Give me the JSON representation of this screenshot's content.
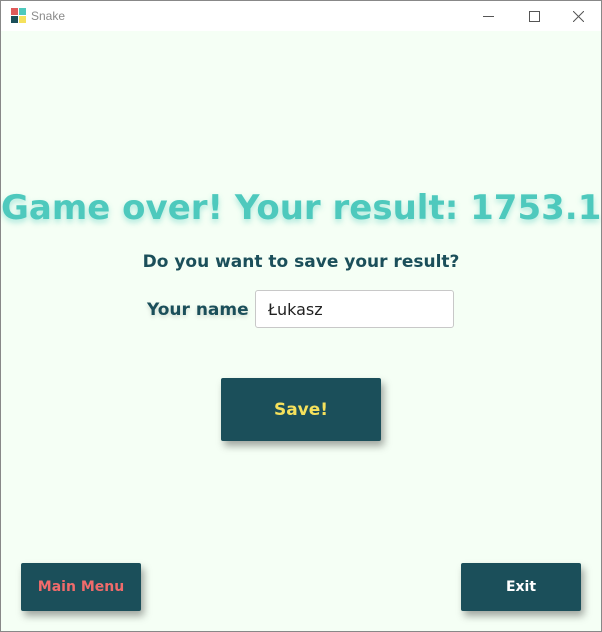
{
  "window": {
    "title": "Snake",
    "icon_colors": [
      "#e05a5a",
      "#4ec9bd",
      "#1b4f5a",
      "#f5e15c"
    ]
  },
  "game_over": {
    "heading": "Game over! Your result: 1753.1",
    "question": "Do you want to save your result?",
    "name_label": "Your name",
    "name_value": "Łukasz",
    "save_label": "Save!"
  },
  "footer": {
    "main_menu_label": "Main Menu",
    "exit_label": "Exit"
  },
  "colors": {
    "background": "#f5fff5",
    "accent_teal": "#4ec9bd",
    "dark_teal": "#1b4f5a",
    "save_text": "#f5e15c",
    "menu_text": "#f06b6b"
  }
}
